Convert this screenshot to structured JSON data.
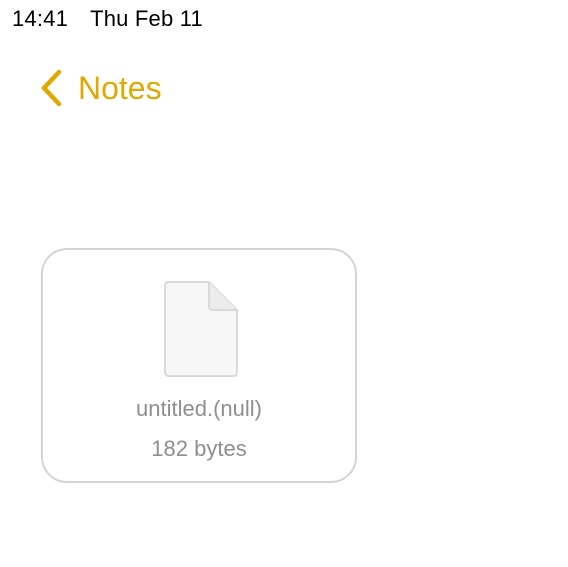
{
  "status_bar": {
    "time": "14:41",
    "date": "Thu Feb 11"
  },
  "nav": {
    "back_label": "Notes",
    "back_icon": "chevron-left-icon"
  },
  "file": {
    "name": "untitled.(null)",
    "size": "182 bytes",
    "icon": "document-icon"
  },
  "colors": {
    "accent": "#e0a800",
    "secondary_text": "#8e8e93",
    "card_border": "#d4d4d4"
  }
}
